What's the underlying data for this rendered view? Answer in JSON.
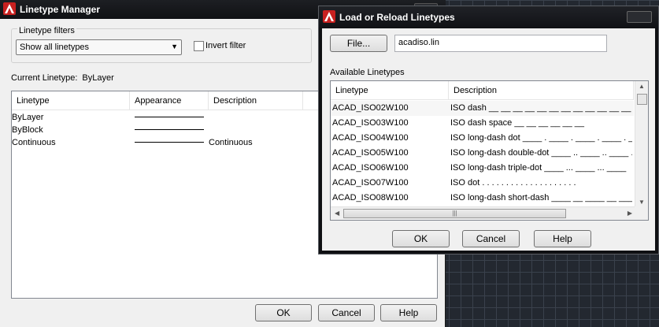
{
  "linetype_manager": {
    "title": "Linetype Manager",
    "filters_group_label": "Linetype filters",
    "filter_value": "Show all linetypes",
    "invert_filter_label": "Invert filter",
    "current_linetype_label": "Current Linetype:",
    "current_linetype_value": "ByLayer",
    "columns": [
      "Linetype",
      "Appearance",
      "Description"
    ],
    "rows": [
      {
        "linetype": "ByLayer",
        "description": ""
      },
      {
        "linetype": "ByBlock",
        "description": ""
      },
      {
        "linetype": "Continuous",
        "description": "Continuous"
      }
    ],
    "buttons": {
      "ok": "OK",
      "cancel": "Cancel",
      "help": "Help"
    }
  },
  "load_dialog": {
    "title": "Load or Reload Linetypes",
    "file_button": "File...",
    "file_value": "acadiso.lin",
    "available_label": "Available Linetypes",
    "columns": [
      "Linetype",
      "Description"
    ],
    "rows": [
      {
        "linetype": "ACAD_ISO02W100",
        "description": "ISO dash __ __ __ __ __ __ __ __ __ __ __ __"
      },
      {
        "linetype": "ACAD_ISO03W100",
        "description": "ISO dash space __    __    __    __    __    __"
      },
      {
        "linetype": "ACAD_ISO04W100",
        "description": "ISO long-dash dot ____ . ____ . ____ . ____ . _"
      },
      {
        "linetype": "ACAD_ISO05W100",
        "description": "ISO long-dash double-dot ____ .. ____ .. ____ ."
      },
      {
        "linetype": "ACAD_ISO06W100",
        "description": "ISO long-dash triple-dot ____ ... ____ ... ____"
      },
      {
        "linetype": "ACAD_ISO07W100",
        "description": "ISO dot . . . . . . . . . . . . . . . . . . . ."
      },
      {
        "linetype": "ACAD_ISO08W100",
        "description": "ISO long-dash short-dash ____ __ ____ __ ____ _"
      }
    ],
    "buttons": {
      "ok": "OK",
      "cancel": "Cancel",
      "help": "Help"
    }
  },
  "icons": {
    "app": "autocad-logo-icon",
    "dropdown": "chevron-down-icon",
    "scroll_up": "arrow-up-icon",
    "scroll_down": "arrow-down-icon",
    "scroll_left": "arrow-left-icon",
    "scroll_right": "arrow-right-icon"
  },
  "colors": {
    "brand_red": "#c8201f",
    "title_bar": "#111216",
    "cad_background": "#232830"
  }
}
